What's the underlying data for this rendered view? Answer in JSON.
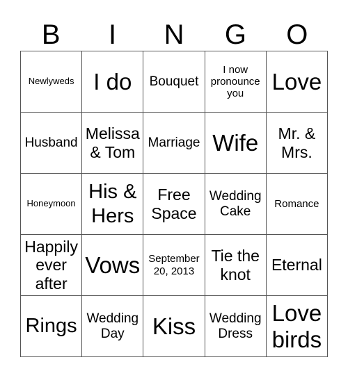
{
  "header": {
    "letters": [
      "B",
      "I",
      "N",
      "G",
      "O"
    ]
  },
  "cells": [
    "Newlyweds",
    "I do",
    "Bouquet",
    "I now pronounce you",
    "Love",
    "Husband",
    "Melissa & Tom",
    "Marriage",
    "Wife",
    "Mr. & Mrs.",
    "Honeymoon",
    "His & Hers",
    "Free Space",
    "Wedding Cake",
    "Romance",
    "Happily ever after",
    "Vows",
    "September 20, 2013",
    "Tie the knot",
    "Eternal",
    "Rings",
    "Wedding Day",
    "Kiss",
    "Wedding Dress",
    "Love birds"
  ]
}
